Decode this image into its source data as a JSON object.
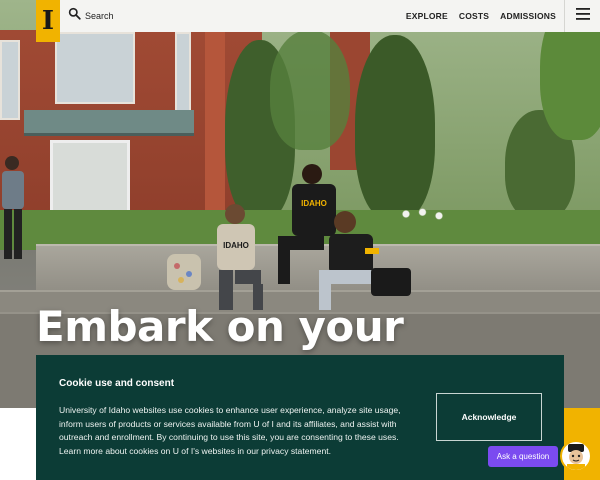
{
  "header": {
    "logo_letter": "I",
    "search_label": "Search",
    "nav_links": [
      "EXPLORE",
      "COSTS",
      "ADMISSIONS"
    ]
  },
  "hero": {
    "heading": "Embark on your"
  },
  "cookie_banner": {
    "title": "Cookie use and consent",
    "body": "University of Idaho websites use cookies to enhance user experience, analyze site usage, inform users of products or services available from U of I and its affiliates, and assist with outreach and enrollment. By continuing to use this site, you are consenting to these uses. Learn more about cookies on U of I's websites in our privacy statement.",
    "button_label": "Acknowledge"
  },
  "chat": {
    "button_label": "Ask a question"
  },
  "colors": {
    "brand_gold": "#f1b300",
    "banner_green": "#0c3c36",
    "chat_purple": "#7b4bf0"
  },
  "icons": [
    "search-icon",
    "hamburger-menu-icon",
    "mascot-avatar-icon"
  ]
}
